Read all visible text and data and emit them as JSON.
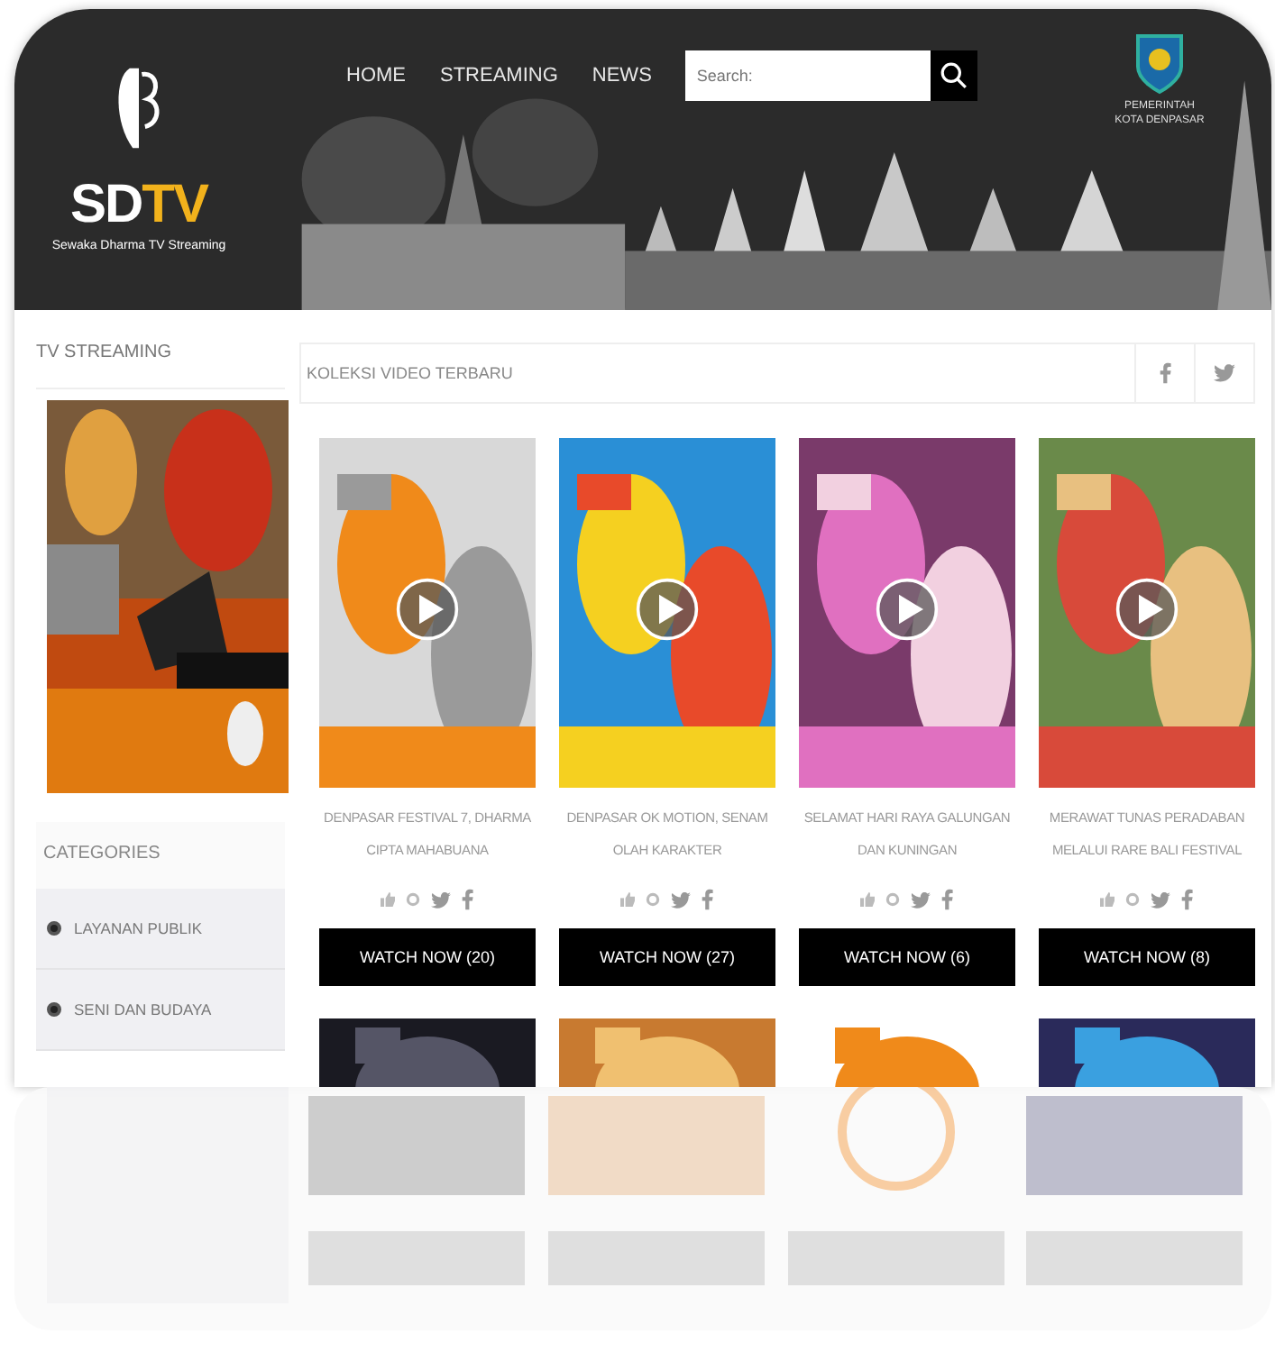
{
  "header": {
    "logo": {
      "parts": [
        {
          "text": "SD",
          "accent": false
        },
        {
          "text": "TV",
          "accent": true
        }
      ],
      "tagline": "Sewaka Dharma TV Streaming"
    },
    "nav": [
      {
        "label": "HOME"
      },
      {
        "label": "STREAMING"
      },
      {
        "label": "NEWS"
      }
    ],
    "search": {
      "placeholder": "Search:"
    },
    "emblem_caption": "PEMERINTAH KOTA DENPASAR"
  },
  "sidebar": {
    "stream_title": "TV STREAMING",
    "categories_title": "CATEGORIES",
    "categories": [
      {
        "label": "LAYANAN PUBLIK"
      },
      {
        "label": "SENI DAN BUDAYA"
      }
    ]
  },
  "main": {
    "title": "KOLEKSI VIDEO TERBARU",
    "videos": [
      {
        "title": "DENPASAR FESTIVAL 7, DHARMA CIPTA MAHABUANA",
        "button": "WATCH NOW (20)"
      },
      {
        "title": "DENPASAR OK MOTION, SENAM OLAH KARAKTER",
        "button": "WATCH NOW (27)"
      },
      {
        "title": "SELAMAT HARI RAYA GALUNGAN DAN KUNINGAN",
        "button": "WATCH NOW (6)"
      },
      {
        "title": "MERAWAT TUNAS PERADABAN MELALUI RARE BALI FESTIVAL",
        "button": "WATCH NOW (8)"
      }
    ]
  }
}
